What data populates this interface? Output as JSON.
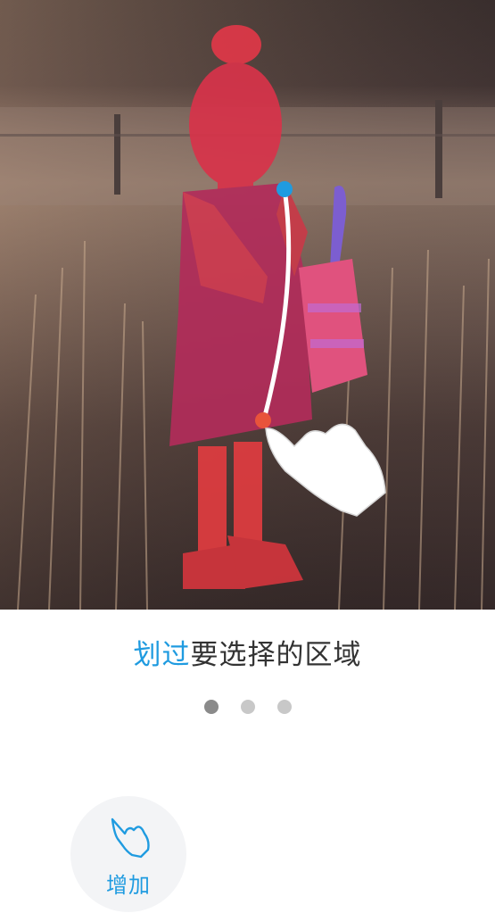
{
  "caption": {
    "highlight": "划过",
    "rest": "要选择的区域"
  },
  "pager": {
    "pages": 3,
    "active_index": 0
  },
  "add_button": {
    "label": "增加",
    "icon": "hand-pointer-icon"
  },
  "colors": {
    "accent": "#1f9be0",
    "selection_overlay": "#e8323c",
    "stroke_start": "#1f9be0",
    "stroke_end": "#e8533b"
  }
}
